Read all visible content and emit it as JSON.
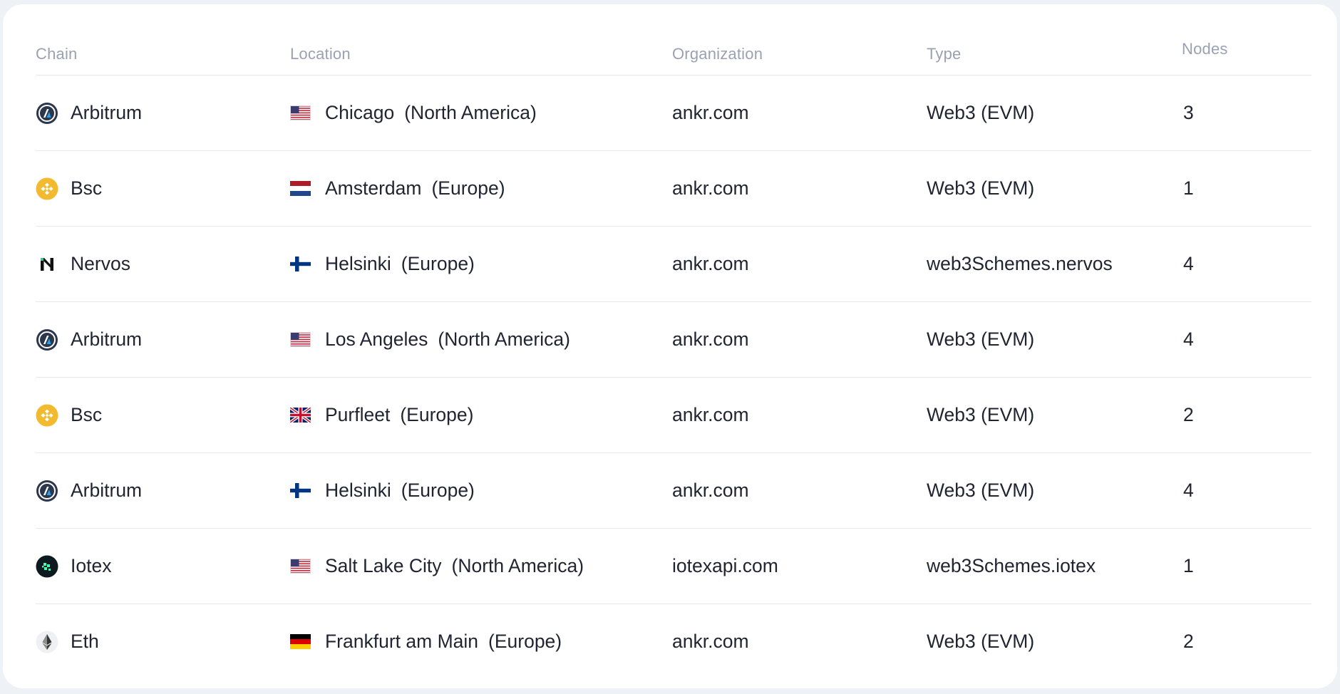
{
  "headers": {
    "chain": "Chain",
    "location": "Location",
    "organization": "Organization",
    "type": "Type",
    "nodes": "Nodes"
  },
  "rows": [
    {
      "chain": "Arbitrum",
      "chain_icon": "arbitrum-icon",
      "flag": "us-flag-icon",
      "city": "Chicago",
      "region": "(North America)",
      "organization": "ankr.com",
      "type": "Web3 (EVM)",
      "nodes": "3"
    },
    {
      "chain": "Bsc",
      "chain_icon": "bsc-icon",
      "flag": "nl-flag-icon",
      "city": "Amsterdam",
      "region": "(Europe)",
      "organization": "ankr.com",
      "type": "Web3 (EVM)",
      "nodes": "1"
    },
    {
      "chain": "Nervos",
      "chain_icon": "nervos-icon",
      "flag": "fi-flag-icon",
      "city": "Helsinki",
      "region": "(Europe)",
      "organization": "ankr.com",
      "type": "web3Schemes.nervos",
      "nodes": "4"
    },
    {
      "chain": "Arbitrum",
      "chain_icon": "arbitrum-icon",
      "flag": "us-flag-icon",
      "city": "Los Angeles",
      "region": "(North America)",
      "organization": "ankr.com",
      "type": "Web3 (EVM)",
      "nodes": "4"
    },
    {
      "chain": "Bsc",
      "chain_icon": "bsc-icon",
      "flag": "gb-flag-icon",
      "city": "Purfleet",
      "region": "(Europe)",
      "organization": "ankr.com",
      "type": "Web3 (EVM)",
      "nodes": "2"
    },
    {
      "chain": "Arbitrum",
      "chain_icon": "arbitrum-icon",
      "flag": "fi-flag-icon",
      "city": "Helsinki",
      "region": "(Europe)",
      "organization": "ankr.com",
      "type": "Web3 (EVM)",
      "nodes": "4"
    },
    {
      "chain": "Iotex",
      "chain_icon": "iotex-icon",
      "flag": "us-flag-icon",
      "city": "Salt Lake City",
      "region": "(North America)",
      "organization": "iotexapi.com",
      "type": "web3Schemes.iotex",
      "nodes": "1"
    },
    {
      "chain": "Eth",
      "chain_icon": "eth-icon",
      "flag": "de-flag-icon",
      "city": "Frankfurt am Main",
      "region": "(Europe)",
      "organization": "ankr.com",
      "type": "Web3 (EVM)",
      "nodes": "2"
    }
  ],
  "colors": {
    "header_text": "#9aa1b1",
    "body_text": "#1f2430",
    "divider": "#e6e8ec",
    "bsc_yellow": "#f3ba2f",
    "arbitrum_dark": "#2d374b",
    "arbitrum_blue": "#28a0f0"
  }
}
